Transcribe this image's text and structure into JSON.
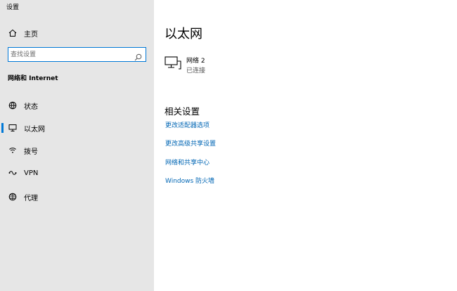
{
  "window": {
    "title": "设置"
  },
  "sidebar": {
    "home": {
      "label": "主页",
      "icon": "home-icon"
    },
    "search": {
      "placeholder": "查找设置",
      "icon": "search-icon"
    },
    "section_heading": "网络和 Internet",
    "items": [
      {
        "label": "状态",
        "icon": "globe-status-icon"
      },
      {
        "label": "以太网",
        "icon": "ethernet-icon",
        "active": true
      },
      {
        "label": "拨号",
        "icon": "dialup-icon"
      },
      {
        "label": "VPN",
        "icon": "vpn-icon"
      },
      {
        "label": "代理",
        "icon": "proxy-globe-icon"
      }
    ]
  },
  "main": {
    "title": "以太网",
    "network": {
      "name": "网络 2",
      "status": "已连接",
      "icon": "ethernet-network-icon"
    },
    "related_title": "相关设置",
    "links": [
      "更改适配器选项",
      "更改高级共享设置",
      "网络和共享中心",
      "Windows 防火墙"
    ]
  },
  "colors": {
    "accent": "#0078d7",
    "link": "#0066b4",
    "sidebar_bg": "#e6e6e6"
  }
}
